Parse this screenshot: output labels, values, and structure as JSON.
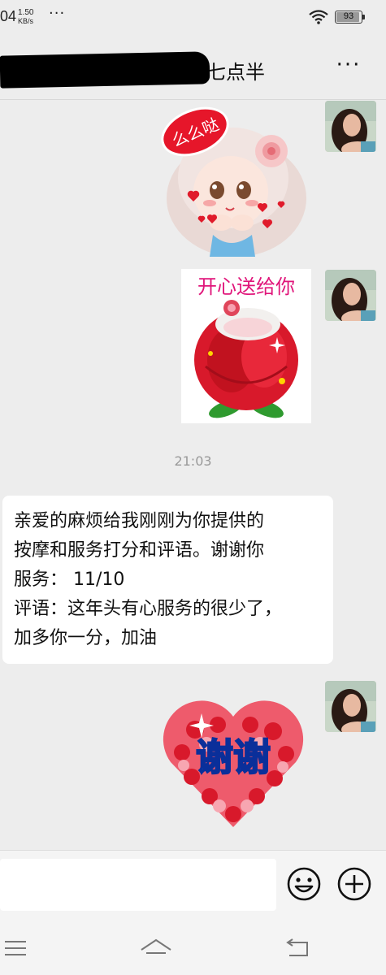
{
  "status_bar": {
    "time_fragment": "04",
    "net_speed_value": "1.50",
    "net_speed_unit": "KB/s",
    "more": "···",
    "battery_level": "93"
  },
  "header": {
    "title_visible": "早七点半",
    "more_label": "···"
  },
  "messages": [
    {
      "type": "sticker",
      "side": "right",
      "sticker_name": "kiss-girl-sticker",
      "text": "么么哒"
    },
    {
      "type": "sticker",
      "side": "right",
      "sticker_name": "rose-sticker",
      "text": "开心送给你"
    },
    {
      "type": "timestamp",
      "text": "21:03"
    },
    {
      "type": "text",
      "side": "left",
      "lines": [
        "亲爱的麻烦给我刚刚为你提供的",
        "按摩和服务打分和评语。谢谢你",
        "服务： 11/10",
        "评语：这年头有心服务的很少了，",
        "加多你一分，加油"
      ]
    },
    {
      "type": "sticker",
      "side": "right",
      "sticker_name": "heart-roses-sticker",
      "text": "谢谢"
    }
  ],
  "input": {
    "value": "",
    "placeholder": ""
  },
  "icons": {
    "emoji": "smiley-face-icon",
    "add": "plus-circle-icon",
    "nav_menu": "menu-icon",
    "nav_home": "home-icon",
    "nav_back": "back-icon"
  },
  "colors": {
    "background": "#ededed",
    "bubble": "#ffffff",
    "timestamp": "#999999",
    "rose_red": "#d8192b",
    "sticker_pink_text": "#e0157a"
  }
}
